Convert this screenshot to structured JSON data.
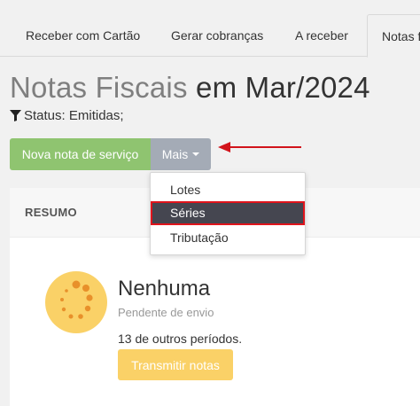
{
  "tabs": [
    {
      "label": "Receber com Cartão"
    },
    {
      "label": "Gerar cobranças"
    },
    {
      "label": "A receber"
    },
    {
      "label": "Notas fiscais"
    }
  ],
  "page": {
    "title_light": "Notas Fiscais",
    "title_dark": "em Mar/2024",
    "status_filter": "Status: Emitidas;"
  },
  "actions": {
    "new_invoice_label": "Nova nota de serviço",
    "more_label": "Mais"
  },
  "dropdown": {
    "items": [
      {
        "label": "Lotes"
      },
      {
        "label": "Séries"
      },
      {
        "label": "Tributação"
      }
    ]
  },
  "summary": {
    "header": "RESUMO",
    "status_title": "Nenhuma",
    "status_subtitle": "Pendente de envio",
    "other_periods": "13 de outros períodos.",
    "transmit_label": "Transmitir notas"
  },
  "colors": {
    "green_button": "#8fc470",
    "grey_button": "#a4abb6",
    "yellow_accent": "#fad167",
    "highlight_red": "#e0141c",
    "selected_item_bg": "#454650"
  }
}
